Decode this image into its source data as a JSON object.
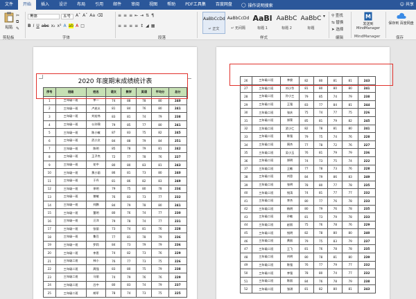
{
  "tabs": [
    "文件",
    "开始",
    "插入",
    "设计",
    "布局",
    "引用",
    "邮件",
    "审阅",
    "视图",
    "帮助",
    "PDF工具集",
    "百度网盘"
  ],
  "active_tab": 1,
  "search_label": "操作说明搜索",
  "share_label": "共享",
  "ribbon": {
    "paste_label": "粘贴",
    "clipboard_group": "剪贴板",
    "font_name": "黑体",
    "font_size": "五号",
    "font_group": "字体",
    "paragraph_group": "段落",
    "styles_group": "样式",
    "styles": [
      {
        "sample": "AaBbCcDd",
        "name": "↵ 正文"
      },
      {
        "sample": "AaBbCcDd",
        "name": "↵ 无间隔"
      },
      {
        "sample": "AaBl",
        "name": "标题 1"
      },
      {
        "sample": "AaBbC",
        "name": "标题 2"
      },
      {
        "sample": "AaBbC",
        "name": "标题"
      }
    ],
    "find_label": "查找",
    "replace_label": "替换",
    "select_label": "选择",
    "edit_group": "编辑",
    "mindmanager_label": "发送到 MindManager",
    "mindmanager_group": "MindManager",
    "save_cloud_label": "保存到 百度网盘",
    "save_group": "保存"
  },
  "document": {
    "title": "2020 年度期末成绩统计表",
    "headers": [
      "序号",
      "班级",
      "姓名",
      "语文",
      "数学",
      "英语",
      "平均分",
      "总分"
    ],
    "page1_rows": [
      [
        "1",
        "三年级一班",
        "李一",
        "74",
        "88",
        "78",
        "80",
        "240"
      ],
      [
        "2",
        "三年级一班",
        "卢启义",
        "81",
        "84",
        "76",
        "80",
        "241"
      ],
      [
        "3",
        "三年级一班",
        "刘宏伟",
        "83",
        "81",
        "74",
        "79",
        "238"
      ],
      [
        "4",
        "三年级一班",
        "公孙锦",
        "79",
        "85",
        "77",
        "80",
        "241"
      ],
      [
        "5",
        "三年级一班",
        "陈小敏",
        "87",
        "83",
        "75",
        "82",
        "245"
      ],
      [
        "6",
        "三年级一班",
        "武小文",
        "84",
        "88",
        "79",
        "84",
        "251"
      ],
      [
        "7",
        "三年级一班",
        "陈明",
        "85",
        "78",
        "79",
        "81",
        "242"
      ],
      [
        "8",
        "三年级一班",
        "王子杰",
        "72",
        "77",
        "78",
        "76",
        "227"
      ],
      [
        "9",
        "三年级一班",
        "花中",
        "80",
        "80",
        "83",
        "81",
        "243"
      ],
      [
        "10",
        "三年级一班",
        "黄小丽",
        "86",
        "81",
        "73",
        "80",
        "240"
      ],
      [
        "11",
        "三年级一班",
        "于丹",
        "81",
        "86",
        "82",
        "83",
        "249"
      ],
      [
        "12",
        "三年级一班",
        "李明",
        "79",
        "75",
        "80",
        "78",
        "234"
      ],
      [
        "13",
        "三年级一班",
        "曾敏",
        "76",
        "83",
        "73",
        "77",
        "232"
      ],
      [
        "14",
        "三年级一班",
        "刘鹏",
        "84",
        "79",
        "78",
        "80",
        "241"
      ],
      [
        "15",
        "三年级一班",
        "董明",
        "80",
        "76",
        "74",
        "77",
        "230"
      ],
      [
        "16",
        "三年级一班",
        "汪洋",
        "79",
        "78",
        "74",
        "77",
        "231"
      ],
      [
        "17",
        "三年级一班",
        "张丽",
        "73",
        "74",
        "81",
        "76",
        "228"
      ],
      [
        "18",
        "三年级一班",
        "鲁豆",
        "77",
        "81",
        "78",
        "79",
        "236"
      ],
      [
        "19",
        "三年级一班",
        "罗莉",
        "84",
        "73",
        "79",
        "79",
        "236"
      ],
      [
        "20",
        "三年级一班",
        "李思",
        "74",
        "82",
        "73",
        "76",
        "229"
      ],
      [
        "21",
        "三年级二班",
        "林小",
        "76",
        "77",
        "73",
        "75",
        "226"
      ],
      [
        "22",
        "三年级二班",
        "周强",
        "83",
        "80",
        "75",
        "79",
        "238"
      ],
      [
        "23",
        "三年级二班",
        "马丽",
        "74",
        "79",
        "76",
        "76",
        "229"
      ],
      [
        "24",
        "三年级二班",
        "吕中",
        "80",
        "83",
        "74",
        "79",
        "237"
      ],
      [
        "25",
        "三年级二班",
        "胡军",
        "78",
        "74",
        "73",
        "75",
        "225"
      ]
    ],
    "page2_rows": [
      [
        "26",
        "三年级二班",
        "李俊",
        "82",
        "80",
        "81",
        "81",
        "243"
      ],
      [
        "27",
        "三年级二班",
        "刘小华",
        "81",
        "80",
        "80",
        "80",
        "241"
      ],
      [
        "28",
        "三年级二班",
        "孙小三",
        "79",
        "85",
        "74",
        "79",
        "238"
      ],
      [
        "29",
        "三年级二班",
        "王强",
        "83",
        "77",
        "84",
        "81",
        "244"
      ],
      [
        "30",
        "三年级二班",
        "张庆",
        "75",
        "74",
        "77",
        "75",
        "226"
      ],
      [
        "31",
        "三年级二班",
        "郑荣",
        "85",
        "81",
        "79",
        "82",
        "245"
      ],
      [
        "32",
        "三年级二班",
        "武小仁",
        "82",
        "78",
        "81",
        "80",
        "241"
      ],
      [
        "33",
        "三年级二班",
        "陈强",
        "79",
        "75",
        "74",
        "76",
        "228"
      ],
      [
        "34",
        "三年级二班",
        "周杰",
        "77",
        "78",
        "72",
        "76",
        "227"
      ],
      [
        "35",
        "三年级二班",
        "吴小玉",
        "76",
        "81",
        "79",
        "79",
        "236"
      ],
      [
        "36",
        "三年级二班",
        "郑明",
        "74",
        "73",
        "75",
        "74",
        "222"
      ],
      [
        "37",
        "三年级二班",
        "王敏",
        "77",
        "78",
        "73",
        "76",
        "228"
      ],
      [
        "38",
        "三年级二班",
        "刘思",
        "84",
        "79",
        "86",
        "83",
        "249"
      ],
      [
        "39",
        "三年级二班",
        "张明",
        "78",
        "80",
        "77",
        "78",
        "235"
      ],
      [
        "40",
        "三年级二班",
        "钱涛",
        "74",
        "81",
        "77",
        "77",
        "232"
      ],
      [
        "41",
        "三年级二班",
        "李杰",
        "80",
        "77",
        "76",
        "78",
        "233"
      ],
      [
        "42",
        "三年级二班",
        "杨明",
        "80",
        "79",
        "76",
        "78",
        "235"
      ],
      [
        "43",
        "三年级二班",
        "孙敏",
        "81",
        "73",
        "79",
        "78",
        "233"
      ],
      [
        "44",
        "三年级二班",
        "赵丽",
        "75",
        "76",
        "78",
        "76",
        "229"
      ],
      [
        "45",
        "三年级二班",
        "钱明",
        "82",
        "78",
        "80",
        "80",
        "240"
      ],
      [
        "46",
        "三年级二班",
        "黄丽",
        "79",
        "75",
        "83",
        "79",
        "237"
      ],
      [
        "47",
        "三年级二班",
        "王飞",
        "81",
        "76",
        "78",
        "78",
        "235"
      ],
      [
        "48",
        "三年级二班",
        "刘明",
        "80",
        "78",
        "81",
        "80",
        "239"
      ],
      [
        "49",
        "三年级二班",
        "陈强",
        "76",
        "77",
        "79",
        "77",
        "232"
      ],
      [
        "50",
        "三年级二班",
        "李强",
        "78",
        "80",
        "74",
        "77",
        "232"
      ],
      [
        "51",
        "三年级二班",
        "陈丽",
        "84",
        "76",
        "78",
        "79",
        "238"
      ],
      [
        "52",
        "三年级二班",
        "张琪",
        "81",
        "82",
        "80",
        "81",
        "243"
      ]
    ]
  },
  "colors": {
    "ribbon_blue": "#2b579a",
    "header_green": "#c6e0b4",
    "highlight_red": "#e0302a"
  }
}
